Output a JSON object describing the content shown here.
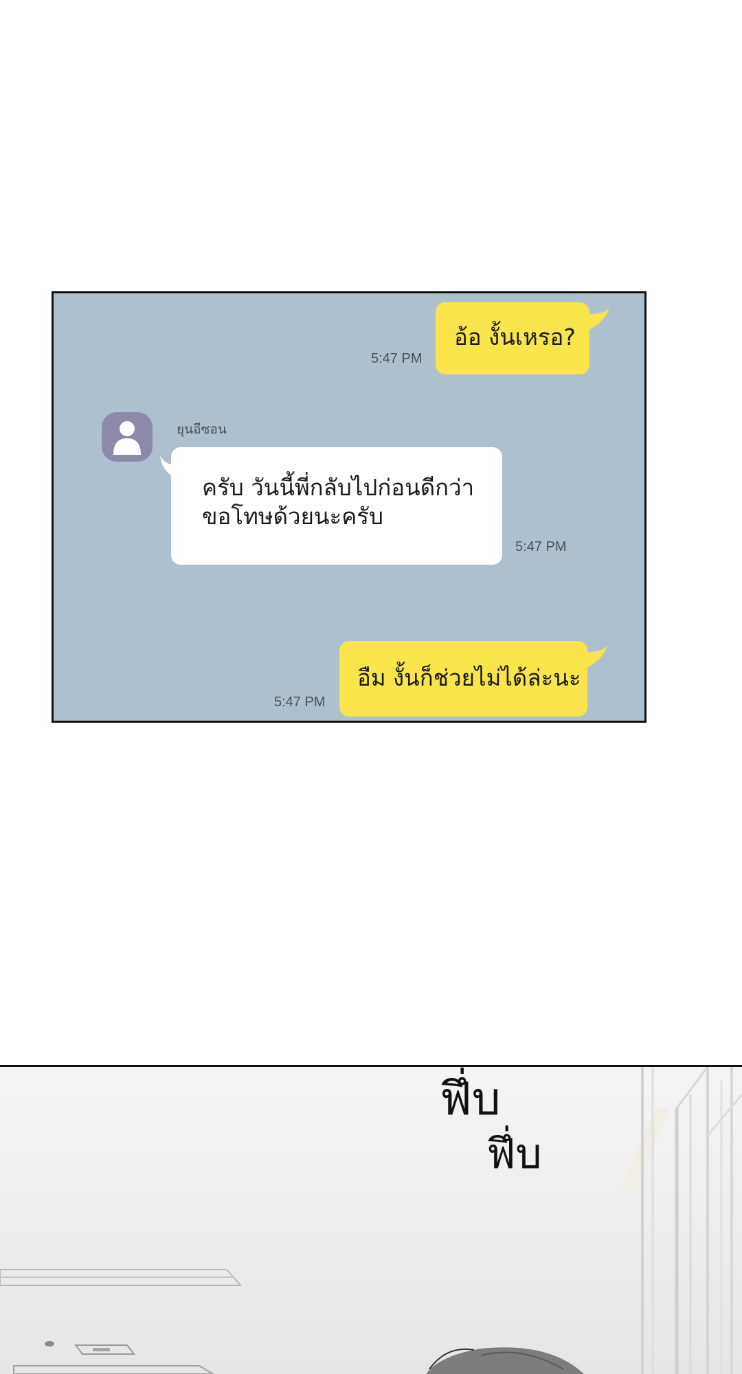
{
  "chat": {
    "messages": [
      {
        "side": "right",
        "text": "อ้อ งั้นเหรอ?",
        "time": "5:47 PM"
      },
      {
        "side": "left",
        "sender": "ยุนอีซอน",
        "text": "ครับ วันนี้พี่กลับไปก่อนดีกว่า\nขอโทษด้วยนะครับ",
        "time": "5:47 PM"
      },
      {
        "side": "right",
        "text": "อืม งั้นก็ช่วยไม่ได้ล่ะนะ",
        "time": "5:47 PM"
      }
    ],
    "colors": {
      "background": "#aec0cd",
      "my_bubble": "#f9e44b",
      "their_bubble": "#ffffff",
      "avatar": "#8c8aa8"
    }
  },
  "scene": {
    "sfx_lines": [
      "ฟึ่บ",
      "ฟึ่บ"
    ]
  }
}
